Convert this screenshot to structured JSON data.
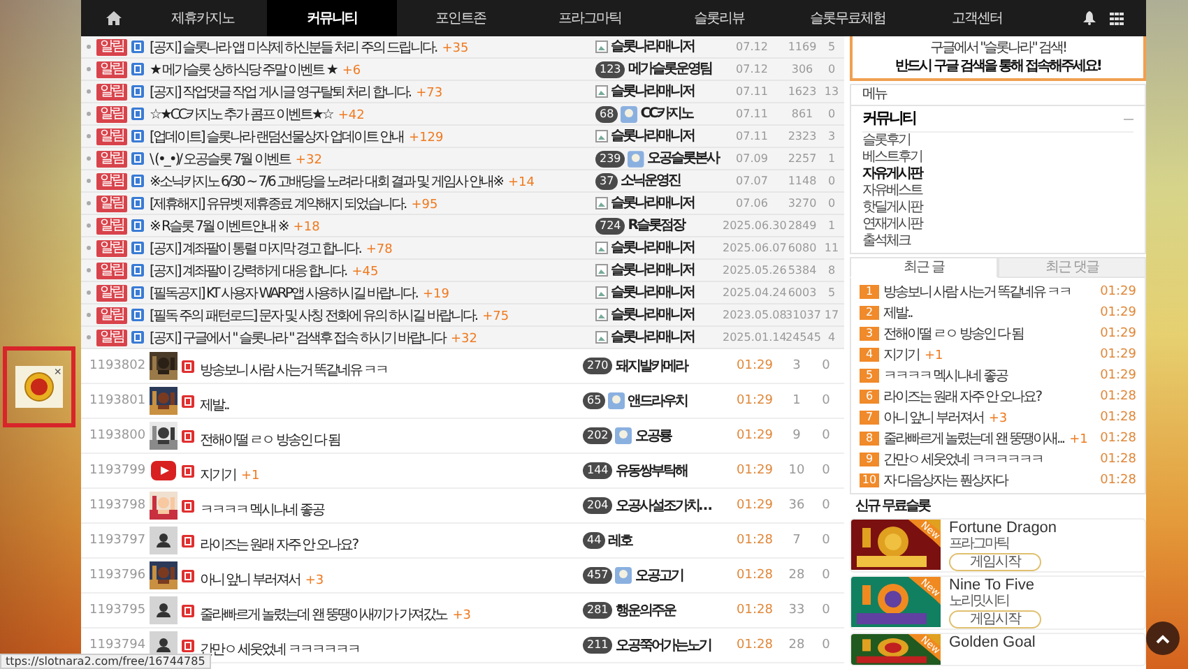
{
  "nav": {
    "items": [
      {
        "label": "제휴카지노",
        "selected": false
      },
      {
        "label": "커뮤니티",
        "selected": true
      },
      {
        "label": "포인트존",
        "selected": false
      },
      {
        "label": "프라그마틱",
        "selected": false
      },
      {
        "label": "슬롯리뷰",
        "selected": false
      },
      {
        "label": "슬롯무료체험",
        "selected": false
      },
      {
        "label": "고객센터",
        "selected": false
      }
    ]
  },
  "notices": [
    {
      "badge": "알림",
      "title": "[공지] 슬롯나라 앱 미삭제 하신분들 처리 주의 드립니다.",
      "comment_count": "+35",
      "author": {
        "kind": "manager",
        "name": "슬롯나라매니저"
      },
      "date": "07.12",
      "views": "1169",
      "replies": "5"
    },
    {
      "badge": "알림",
      "title": "★ 메가슬롯 상하식당 주말 이벤트 ★",
      "comment_count": "+6",
      "author": {
        "kind": "member",
        "rank": "123",
        "name": "메가슬롯운영팀"
      },
      "date": "07.12",
      "views": "306",
      "replies": "0"
    },
    {
      "badge": "알림",
      "title": "[공지] 작업댓글 작업 게시글 영구탈퇴 처리 합니다.",
      "comment_count": "+73",
      "author": {
        "kind": "manager",
        "name": "슬롯나라매니저"
      },
      "date": "07.11",
      "views": "1623",
      "replies": "13"
    },
    {
      "badge": "알림",
      "title": "☆★CC카지노 추가 콤프 이벤트★☆",
      "comment_count": "+42",
      "author": {
        "kind": "member",
        "rank": "68",
        "avatar": true,
        "name": "CC카지노"
      },
      "date": "07.11",
      "views": "861",
      "replies": "0"
    },
    {
      "badge": "알림",
      "title": "[업데이트] 슬롯나라 랜덤선물상자 업데이트 안내",
      "comment_count": "+129",
      "author": {
        "kind": "manager",
        "name": "슬롯나라매니저"
      },
      "date": "07.11",
      "views": "2323",
      "replies": "3"
    },
    {
      "badge": "알림",
      "title": "\\ (•_•)/ 오공슬롯 7월 이벤트",
      "comment_count": "+32",
      "author": {
        "kind": "member",
        "rank": "239",
        "avatar": true,
        "name": "오공슬롯본사"
      },
      "date": "07.09",
      "views": "2257",
      "replies": "1"
    },
    {
      "badge": "알림",
      "title": "※소닉카지노 6/30 ~ 7/6 고배당을 노려라 대회 결과 및 게임사 안내※",
      "comment_count": "+14",
      "author": {
        "kind": "member",
        "rank": "37",
        "name": "소닉운영진"
      },
      "date": "07.07",
      "views": "1148",
      "replies": "0"
    },
    {
      "badge": "알림",
      "title": "[제휴해지] 유뮤벳 제휴종료 계약해지 되었습니다.",
      "comment_count": "+95",
      "author": {
        "kind": "manager",
        "name": "슬롯나라매니저"
      },
      "date": "07.06",
      "views": "3270",
      "replies": "0"
    },
    {
      "badge": "알림",
      "title": "※ R슬롯 7월 이벤트안내 ※",
      "comment_count": "+18",
      "author": {
        "kind": "member",
        "rank": "724",
        "name": "R슬롯점장"
      },
      "date": "2025.06.30",
      "views": "2849",
      "replies": "1"
    },
    {
      "badge": "알림",
      "title": "[공지] 계좌팔이 통렬 마지막 경고 합니다.",
      "comment_count": "+78",
      "author": {
        "kind": "manager",
        "name": "슬롯나라매니저"
      },
      "date": "2025.06.07",
      "views": "6080",
      "replies": "11"
    },
    {
      "badge": "알림",
      "title": "[공지] 계좌팔이 강력하게 대응 합니다.",
      "comment_count": "+45",
      "author": {
        "kind": "manager",
        "name": "슬롯나라매니저"
      },
      "date": "2025.05.26",
      "views": "5384",
      "replies": "8"
    },
    {
      "badge": "알림",
      "title": "[필독공지] KT 사용자 WARP앱 사용하시길 바랍니다.",
      "comment_count": "+19",
      "author": {
        "kind": "manager",
        "name": "슬롯나라매니저"
      },
      "date": "2025.04.24",
      "views": "6003",
      "replies": "5"
    },
    {
      "badge": "알림",
      "title": "[필독 주의 패턴로드] 문자 및 사칭 전화에 유의 하시길 바랍니다.",
      "comment_count": "+75",
      "author": {
        "kind": "manager",
        "name": "슬롯나라매니저"
      },
      "date": "2023.05.08",
      "views": "31037",
      "replies": "17"
    },
    {
      "badge": "알림",
      "title": "[공지] 구글에서 \" 슬롯나라 \" 검색후 접속 하시기 바랍니다",
      "comment_count": "+32",
      "author": {
        "kind": "manager",
        "name": "슬롯나라매니저"
      },
      "date": "2025.01.14",
      "views": "24545",
      "replies": "4"
    }
  ],
  "posts": [
    {
      "number": "1193802",
      "kind": "picture",
      "title": "방송보니 사람 사는거 똑같네유 ㅋㅋ",
      "author": {
        "kind": "member",
        "rank": "270",
        "name": "돼지발카메라"
      },
      "time": "01:29",
      "views": "3",
      "replies": "0"
    },
    {
      "number": "1193801",
      "kind": "picture",
      "title": "제발..",
      "author": {
        "kind": "member",
        "rank": "65",
        "avatar": true,
        "name": "앤드라우치"
      },
      "time": "01:29",
      "views": "1",
      "replies": "0"
    },
    {
      "number": "1193800",
      "kind": "picture",
      "title": "전해이떨 ㄹㅇ 방송인 다 됨",
      "author": {
        "kind": "member",
        "rank": "202",
        "avatar": true,
        "name": "오공룡"
      },
      "time": "01:29",
      "views": "9",
      "replies": "0"
    },
    {
      "number": "1193799",
      "kind": "video",
      "title": "지기기",
      "comment_count": "+1",
      "author": {
        "kind": "member",
        "rank": "144",
        "name": "유동쌍부탁해"
      },
      "time": "01:29",
      "views": "10",
      "replies": "0"
    },
    {
      "number": "1193798",
      "kind": "picture",
      "title": "ㅋㅋㅋㅋ 멕시나네 좋공",
      "author": {
        "kind": "member",
        "rank": "204",
        "name": "오공사설조가치…"
      },
      "time": "01:29",
      "views": "36",
      "replies": "0"
    },
    {
      "number": "1193797",
      "kind": "default",
      "title": "라이즈는 원래 자주 안 오나요?",
      "author": {
        "kind": "member",
        "rank": "44",
        "name": "레호"
      },
      "time": "01:28",
      "views": "7",
      "replies": "0"
    },
    {
      "number": "1193796",
      "kind": "picture",
      "title": "아니 앞니 부러져서",
      "comment_count": "+3",
      "author": {
        "kind": "member",
        "rank": "457",
        "avatar": true,
        "name": "오공고기"
      },
      "time": "01:28",
      "views": "28",
      "replies": "0"
    },
    {
      "number": "1193795",
      "kind": "default",
      "title": "줄라빠르게 놀렸는데 왠 뚱땡이새끼가 가져갔노",
      "comment_count": "+3",
      "author": {
        "kind": "member",
        "rank": "281",
        "name": "행운의주운"
      },
      "time": "01:28",
      "views": "33",
      "replies": "0"
    },
    {
      "number": "1193794",
      "kind": "default",
      "title": "간만ㅇ 세웃었네 ㅋㅋㅋㅋㅋㅋ",
      "author": {
        "kind": "member",
        "rank": "211",
        "name": "오공쭉어가는노기"
      },
      "time": "01:28",
      "views": "28",
      "replies": "0"
    }
  ],
  "sidebar": {
    "banner": {
      "line1": "구글에서 \"슬롯나라\" 검색!",
      "line2": "반드시 구글 검색을 통해 접속해주세요!"
    },
    "menu": {
      "header": "메뉴",
      "section": "커뮤니티",
      "expanded": true,
      "items": [
        {
          "label": "슬롯후기",
          "selected": false
        },
        {
          "label": "베스트후기",
          "selected": false
        },
        {
          "label": "자유게시판",
          "selected": true
        },
        {
          "label": "자유베스트",
          "selected": false
        },
        {
          "label": "핫딜게시판",
          "selected": false
        },
        {
          "label": "연재게시판",
          "selected": false
        },
        {
          "label": "출석체크",
          "selected": false
        }
      ]
    },
    "tabs": [
      {
        "label": "최근 글",
        "selected": true
      },
      {
        "label": "최근 댓글",
        "selected": false
      }
    ],
    "recent": [
      {
        "rank": "1",
        "title": "방송보니 사람 사는거 똑같네유 ㅋㅋ",
        "time": "01:29"
      },
      {
        "rank": "2",
        "title": "제발..",
        "time": "01:29"
      },
      {
        "rank": "3",
        "title": "전해이떨 ㄹㅇ 방송인 다 됨",
        "time": "01:29"
      },
      {
        "rank": "4",
        "title": "지기기",
        "comment_count": "+1",
        "time": "01:29"
      },
      {
        "rank": "5",
        "title": "ㅋㅋㅋㅋ 멕시나네 좋공",
        "time": "01:29"
      },
      {
        "rank": "6",
        "title": "라이즈는 원래 자주 안 오나요?",
        "time": "01:28"
      },
      {
        "rank": "7",
        "title": "아니 앞니 부러져서",
        "comment_count": "+3",
        "time": "01:28"
      },
      {
        "rank": "8",
        "title": "줄라빠르게 놀렸는데 왠 뚱땡이새...",
        "comment_count": "+1",
        "time": "01:28"
      },
      {
        "rank": "9",
        "title": "간만ㅇ 세웃었네 ㅋㅋㅋㅋㅋㅋ",
        "time": "01:28"
      },
      {
        "rank": "10",
        "title": "자 다음상자는 풘상자다",
        "time": "01:28"
      }
    ],
    "games_title": "신규 무료슬롯",
    "games": [
      {
        "badge": "New",
        "name": "Fortune Dragon",
        "provider": "프라그마틱",
        "button": "게임시작"
      },
      {
        "badge": "New",
        "name": "Nine To Five",
        "provider": "노리밋시티",
        "button": "게임시작"
      },
      {
        "badge": "New",
        "name": "Golden Goal"
      }
    ]
  },
  "ad": {
    "close": "×"
  },
  "status_url": "ttps://slotnara2.com/free/16744785"
}
